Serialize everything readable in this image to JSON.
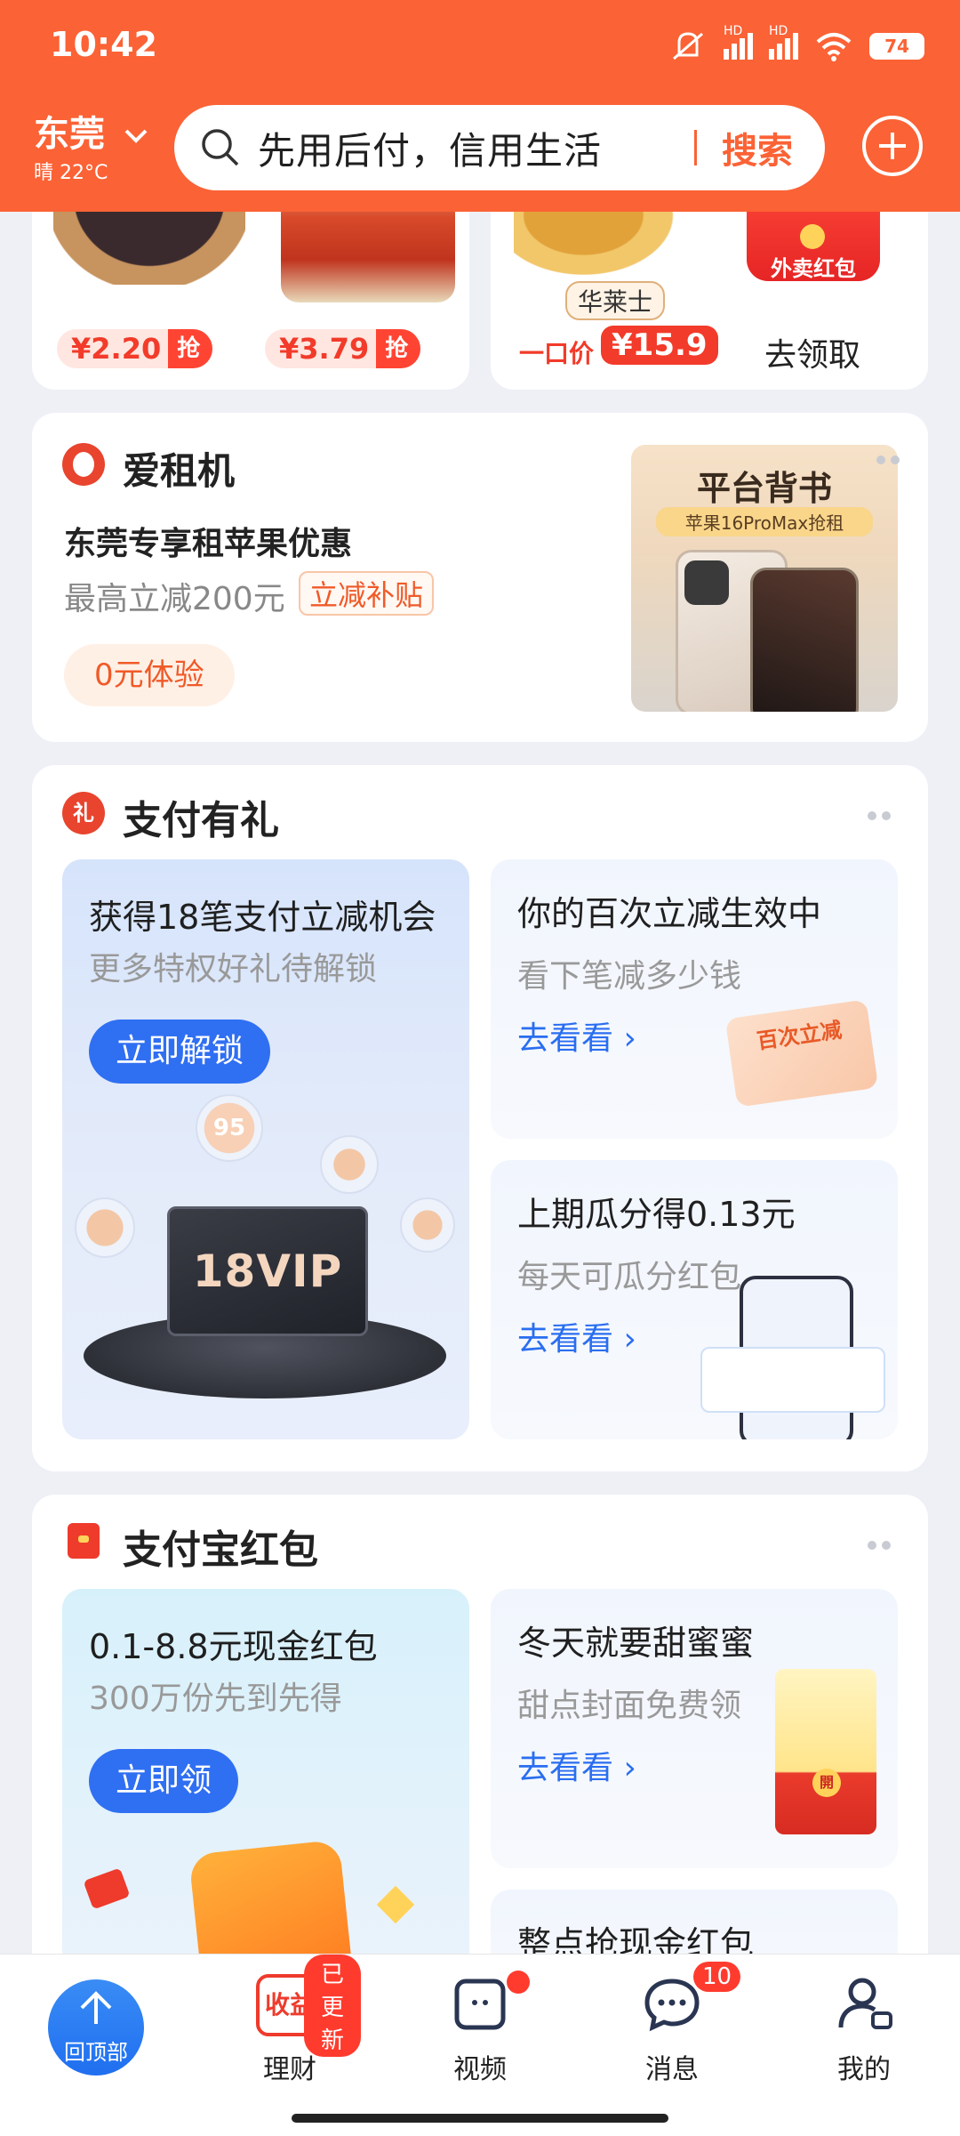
{
  "status": {
    "time": "10:42",
    "battery": "74",
    "signal1": "HD",
    "signal2": "HD"
  },
  "header": {
    "city": "东莞",
    "weather": "晴 22°C",
    "search_placeholder": "先用后付，信用生活",
    "search_button": "搜索"
  },
  "deals": {
    "items": [
      {
        "price": "¥2.20",
        "tag": "抢"
      },
      {
        "price": "¥3.79",
        "tag": "抢"
      }
    ],
    "right": {
      "brand": "华莱士",
      "price_label": "一口价",
      "price": "¥15.9",
      "coupon_label": "外卖红包",
      "claim": "去领取"
    }
  },
  "rent": {
    "title": "爱租机",
    "headline": "东莞专享租苹果优惠",
    "sub": "最高立减200元",
    "tag": "立减补贴",
    "button": "0元体验",
    "banner_title": "平台背书",
    "banner_sub": "苹果16ProMax抢租"
  },
  "pay_gift": {
    "title": "支付有礼",
    "icon_char": "礼",
    "main": {
      "title": "获得18笔支付立减机会",
      "sub": "更多特权好礼待解锁",
      "button": "立即解锁",
      "vip_label": "18VIP",
      "coin": "95"
    },
    "tile1": {
      "title": "你的百次立减生效中",
      "sub": "看下笔减多少钱",
      "link": "去看看",
      "card_text": "百次立减"
    },
    "tile2": {
      "title": "上期瓜分得0.13元",
      "sub": "每天可瓜分红包",
      "link": "去看看"
    }
  },
  "red_packet": {
    "title": "支付宝红包",
    "main": {
      "title": "0.1-8.8元现金红包",
      "sub": "300万份先到先得",
      "button": "立即领"
    },
    "tile1": {
      "title": "冬天就要甜蜜蜜",
      "sub": "甜点封面免费领",
      "link": "去看看",
      "open_char": "開"
    },
    "tile2": {
      "title": "整点抢现金红包"
    }
  },
  "nav": {
    "back_top": "回顶部",
    "items": [
      {
        "label": "理财",
        "icon_text": "收益",
        "badge": "已更新"
      },
      {
        "label": "视频"
      },
      {
        "label": "消息",
        "badge": "10"
      },
      {
        "label": "我的"
      }
    ]
  },
  "colors": {
    "brand": "#fb6235",
    "blue": "#2f6ff2",
    "red": "#ff3b2e"
  }
}
